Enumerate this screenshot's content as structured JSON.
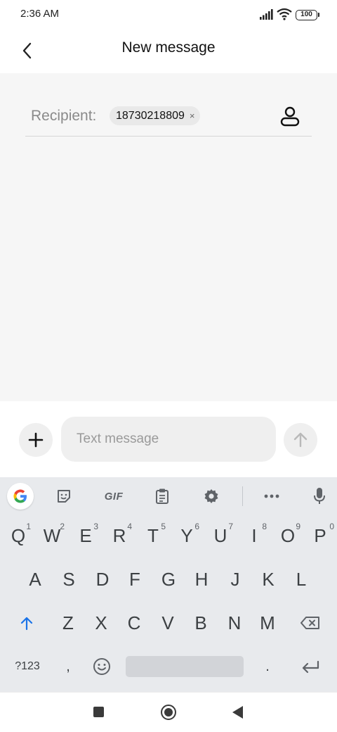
{
  "status_bar": {
    "time": "2:36 AM",
    "battery": "100"
  },
  "header": {
    "title": "New message",
    "back_icon": "chevron-left-icon"
  },
  "recipient": {
    "label": "Recipient:",
    "chip_number": "18730218809",
    "chip_remove": "×",
    "contact_icon": "person-icon"
  },
  "compose": {
    "placeholder": "Text message",
    "add_icon": "plus-icon",
    "send_icon": "arrow-up-icon"
  },
  "keyboard": {
    "toolbar": {
      "gif_label": "GIF",
      "google_icon": "google-g-icon",
      "sticker_icon": "sticker-icon",
      "clipboard_icon": "clipboard-icon",
      "settings_icon": "gear-icon",
      "more_icon": "more-horizontal-icon",
      "mic_icon": "microphone-icon"
    },
    "row1": [
      "Q",
      "W",
      "E",
      "R",
      "T",
      "Y",
      "U",
      "I",
      "O",
      "P"
    ],
    "row1_hints": [
      "1",
      "2",
      "3",
      "4",
      "5",
      "6",
      "7",
      "8",
      "9",
      "0"
    ],
    "row2": [
      "A",
      "S",
      "D",
      "F",
      "G",
      "H",
      "J",
      "K",
      "L"
    ],
    "row3": [
      "Z",
      "X",
      "C",
      "V",
      "B",
      "N",
      "M"
    ],
    "row4": {
      "symbols": "?123",
      "comma": ",",
      "period": "."
    },
    "accent_color": "#1a73e8"
  },
  "nav_bar": {
    "recents_icon": "square-icon",
    "home_icon": "circle-icon",
    "back_icon": "triangle-back-icon"
  }
}
